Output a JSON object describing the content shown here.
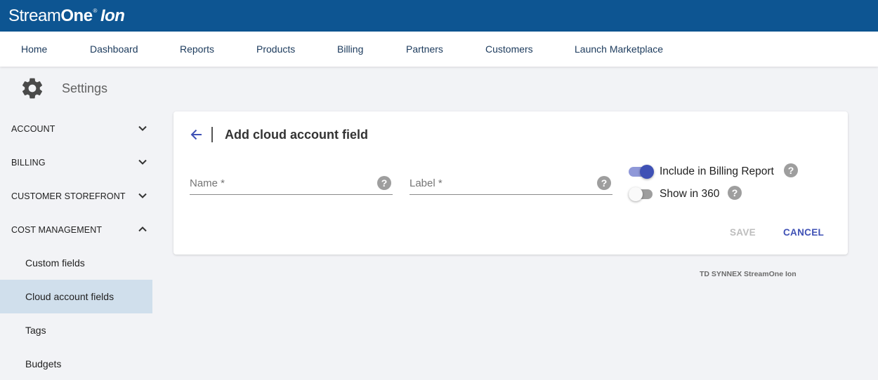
{
  "brand": {
    "part1": "Stream",
    "part2": "One",
    "registered": "®",
    "part3": "Ion"
  },
  "nav": [
    "Home",
    "Dashboard",
    "Reports",
    "Products",
    "Billing",
    "Partners",
    "Customers",
    "Launch Marketplace"
  ],
  "settings": {
    "title": "Settings",
    "icon": "gear-icon"
  },
  "sidebar": {
    "sections": [
      "ACCOUNT",
      "BILLING",
      "CUSTOMER STOREFRONT",
      "COST MANAGEMENT"
    ],
    "sub_items": [
      "Custom fields",
      "Cloud account fields",
      "Tags",
      "Budgets"
    ],
    "active_item": "Cloud account fields"
  },
  "form": {
    "title": "Add cloud account field",
    "name_placeholder": "Name *",
    "label_placeholder": "Label *",
    "include_billing_label": "Include in Billing Report",
    "include_billing_on": true,
    "show_360_label": "Show in 360",
    "show_360_on": false,
    "help_glyph": "?",
    "save_label": "SAVE",
    "cancel_label": "CANCEL"
  },
  "footer": "TD SYNNEX StreamOne Ion",
  "colors": {
    "header": "#0d5592",
    "accent": "#3f51b5",
    "active_bg": "#d0dfec",
    "background": "#f2f3f6"
  }
}
